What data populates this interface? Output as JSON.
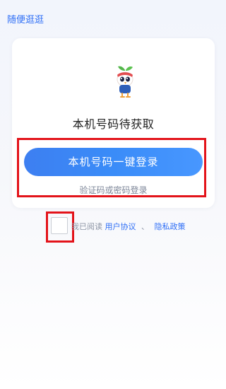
{
  "header": {
    "browse_label": "随便逛逛"
  },
  "card": {
    "phone_status": "本机号码待获取",
    "one_click_login_label": "本机号码一键登录",
    "alt_login_label": "验证码或密码登录"
  },
  "agreement": {
    "prefix": "我已阅读",
    "user_agreement": "用户协议",
    "separator": "、",
    "privacy_policy": "隐私政策"
  },
  "colors": {
    "accent": "#3a8cf8",
    "link": "#2f6ff6",
    "highlight": "#e3131a"
  },
  "icons": {
    "mascot": "mascot-icon"
  }
}
